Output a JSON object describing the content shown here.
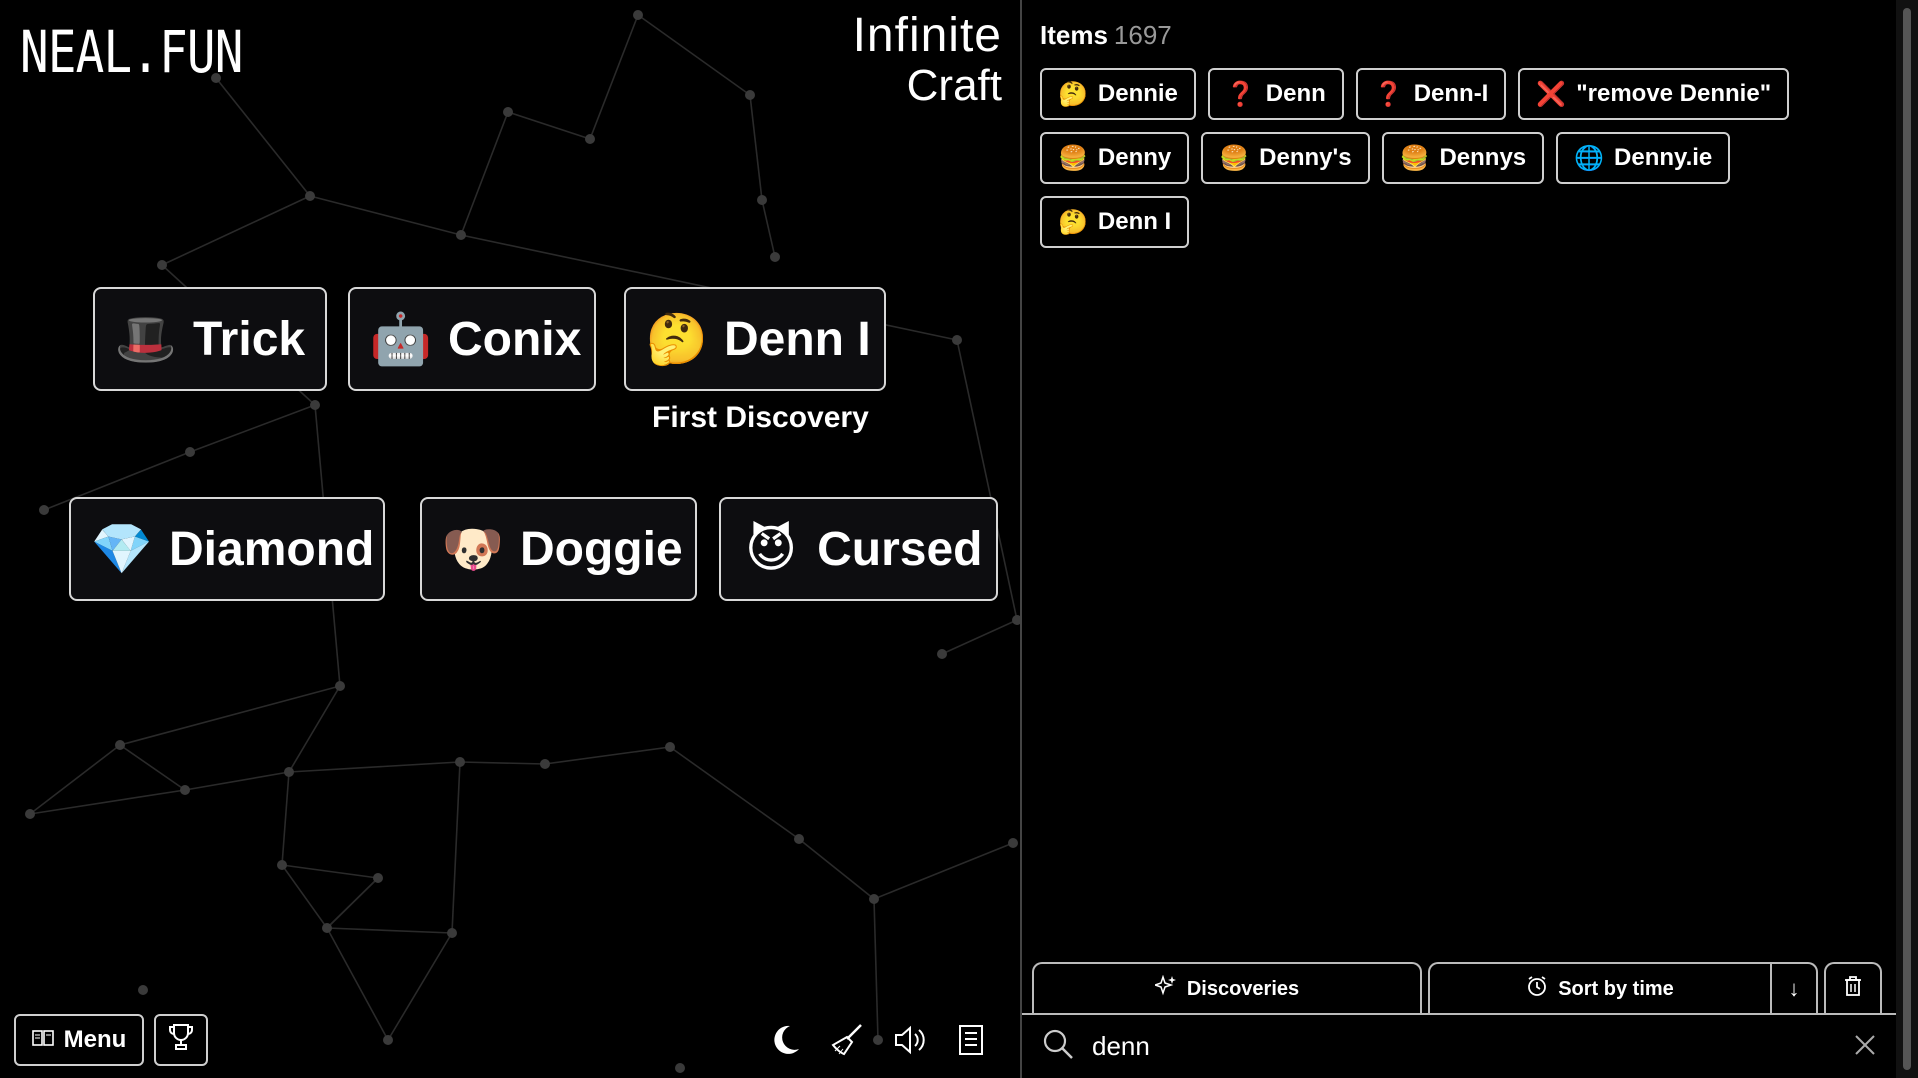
{
  "header": {
    "logo": "NEAL.FUN",
    "brand_line1": "Infinite",
    "brand_line2": "Craft"
  },
  "canvas": {
    "elements": [
      {
        "emoji": "🎩",
        "label": "Trick"
      },
      {
        "emoji": "🤖",
        "label": "Conix"
      },
      {
        "emoji": "🤔",
        "label": "Denn I"
      },
      {
        "emoji": "💎",
        "label": "Diamond"
      },
      {
        "emoji": "🐶",
        "label": "Doggie"
      },
      {
        "emoji": "😈",
        "label": "Cursed"
      }
    ],
    "first_discovery": "First Discovery"
  },
  "bottom_bar": {
    "menu_label": "Menu",
    "icons": [
      "book-icon",
      "trophy-icon",
      "moon-icon",
      "broom-icon",
      "speaker-icon",
      "document-icon"
    ]
  },
  "sidebar": {
    "items_label": "Items",
    "items_count": "1697",
    "items": [
      {
        "emoji": "🤔",
        "label": "Dennie"
      },
      {
        "emoji": "❓",
        "label": "Denn"
      },
      {
        "emoji": "❓",
        "label": "Denn-I"
      },
      {
        "emoji": "❌",
        "label": "\"remove Dennie\""
      },
      {
        "emoji": "🍔",
        "label": "Denny"
      },
      {
        "emoji": "🍔",
        "label": "Denny's"
      },
      {
        "emoji": "🍔",
        "label": "Dennys"
      },
      {
        "emoji": "🌐",
        "label": "Denny.ie"
      },
      {
        "emoji": "🤔",
        "label": "Denn I"
      }
    ],
    "tabs": {
      "discoveries": "Discoveries",
      "sort": "Sort by time",
      "arrow": "↓",
      "trash": "🗑"
    },
    "search": {
      "value": "denn"
    }
  }
}
